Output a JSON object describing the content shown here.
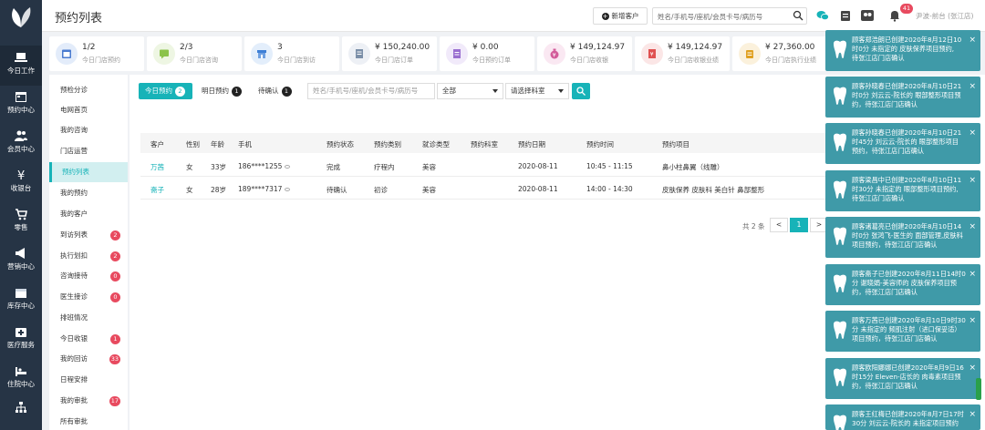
{
  "app": {
    "page_title": "预约列表",
    "new_customer_label": "新增客户",
    "search_placeholder": "姓名/手机号/座机/会员卡号/病历号",
    "notification_count": "41",
    "user_name": "尹波-前台 (张江店)",
    "accent_color": "#17b3b8"
  },
  "left_nav": [
    {
      "label": "今日工作",
      "icon": "laptop-icon"
    },
    {
      "label": "预约中心",
      "icon": "calendar-icon"
    },
    {
      "label": "会员中心",
      "icon": "users-icon"
    },
    {
      "label": "收银台",
      "icon": "yen-icon"
    },
    {
      "label": "零售",
      "icon": "cart-icon"
    },
    {
      "label": "营销中心",
      "icon": "megaphone-icon"
    },
    {
      "label": "库存中心",
      "icon": "box-icon"
    },
    {
      "label": "医疗服务",
      "icon": "medkit-icon"
    },
    {
      "label": "住院中心",
      "icon": "bed-icon"
    },
    {
      "label": "",
      "icon": "org-chart-icon"
    }
  ],
  "stats": [
    {
      "value": "1/2",
      "label": "今日门店预约",
      "color": "#4a7bd0",
      "bg": "#e3ecfa"
    },
    {
      "value": "2/3",
      "label": "今日门店咨询",
      "color": "#8bc34a",
      "bg": "#eef6e3"
    },
    {
      "value": "3",
      "label": "今日门店到访",
      "color": "#3d7fd6",
      "bg": "#e3eefb"
    },
    {
      "value": "¥ 150,240.00",
      "label": "今日门店订单",
      "color": "#7b8fa8",
      "bg": "#edf0f5"
    },
    {
      "value": "¥ 0.00",
      "label": "今日预约订单",
      "color": "#9a6fd0",
      "bg": "#f1eafa"
    },
    {
      "value": "¥ 149,124.97",
      "label": "今日门店收银",
      "color": "#d35d9a",
      "bg": "#fae8f2"
    },
    {
      "value": "¥ 149,124.97",
      "label": "今日门店收银业绩",
      "color": "#e05050",
      "bg": "#fbe6e6"
    },
    {
      "value": "¥ 27,360.00",
      "label": "今日门店执行业绩",
      "color": "#e0a020",
      "bg": "#fbf1dc"
    }
  ],
  "sub_nav": [
    {
      "label": "预检分诊",
      "badge": ""
    },
    {
      "label": "电网首页",
      "badge": ""
    },
    {
      "label": "我的咨询",
      "badge": ""
    },
    {
      "label": "门店运营",
      "badge": ""
    },
    {
      "label": "预约列表",
      "badge": "",
      "active": true
    },
    {
      "label": "我的预约",
      "badge": ""
    },
    {
      "label": "我的客户",
      "badge": ""
    },
    {
      "label": "到访列表",
      "badge": "2"
    },
    {
      "label": "执行划扣",
      "badge": "2"
    },
    {
      "label": "咨询接待",
      "badge": "0"
    },
    {
      "label": "医生接诊",
      "badge": "0"
    },
    {
      "label": "排班情况",
      "badge": ""
    },
    {
      "label": "今日收银",
      "badge": "1"
    },
    {
      "label": "我的回访",
      "badge": "33"
    },
    {
      "label": "日程安排",
      "badge": ""
    },
    {
      "label": "我的审批",
      "badge": "17"
    },
    {
      "label": "所有审批",
      "badge": ""
    }
  ],
  "tabs": [
    {
      "label": "今日预约",
      "count": "2",
      "active": true
    },
    {
      "label": "明日预约",
      "count": "1"
    },
    {
      "label": "待确认",
      "count": "1"
    }
  ],
  "filters": {
    "search_placeholder": "姓名/手机号/座机/会员卡号/病历号",
    "status": "全部",
    "department": "请选择科室"
  },
  "table": {
    "headers": [
      "客户",
      "性别",
      "年龄",
      "手机",
      "预约状态",
      "预约类别",
      "就诊类型",
      "预约科室",
      "预约日期",
      "预约时间",
      "预约项目"
    ],
    "rows": [
      [
        "万茜",
        "女",
        "33岁",
        "186****1255",
        "完成",
        "疗程内",
        "美容",
        "",
        "2020-08-11",
        "10:45 - 11:15",
        "鼻小柱鼻翼（线雕）"
      ],
      [
        "斋子",
        "女",
        "28岁",
        "189****7317",
        "待确认",
        "初诊",
        "美容",
        "",
        "2020-08-11",
        "14:00 - 14:30",
        "皮肤保养 皮肤科 美白针 鼻部整形"
      ]
    ]
  },
  "pagination": {
    "total": "共 2 条",
    "prev": "<",
    "current": "1",
    "next": ">"
  },
  "toasts": [
    {
      "lines": [
        "顾客郑浩朗已创建2020年8月12日10",
        "时0分 未指定的 皮肤保养项目预约,",
        "待张江店门店确认"
      ]
    },
    {
      "lines": [
        "顾客孙晓春已创建2020年8月10日21",
        "时0分 刘云云-院长的 眼部整形项目预",
        "约，待张江店门店确认"
      ]
    },
    {
      "lines": [
        "顾客孙晓春已创建2020年8月10日21",
        "时45分 刘云云-院长的 眼部整形项目",
        "预约，待张江店门店确认"
      ]
    },
    {
      "lines": [
        "顾客梁昌中已创建2020年8月10日11",
        "时30分 未指定的 眼部整形项目预约,",
        "待张江店门店确认"
      ]
    },
    {
      "lines": [
        "顾客诸葛亮已创建2020年8月10日14",
        "时0分 张鸿飞-医生的 面部管理,皮肤科",
        "项目预约，待张江店门店确认"
      ]
    },
    {
      "lines": [
        "顾客斋子已创建2020年8月11日14时0",
        "分 谢晓娟-美容师的 皮肤保养项目预",
        "约，待张江店门店确认"
      ]
    },
    {
      "lines": [
        "顾客万茜已创建2020年8月10日9时30",
        "分 未指定的 频肌注射（进口保妥适）",
        "项目预约，待张江店门店确认"
      ]
    },
    {
      "lines": [
        "顾客欧阳娜娜已创建2020年8月9日16",
        "时15分 Eleven-店长的 肉毒素项目预",
        "约，待张江店门店确认"
      ]
    },
    {
      "lines": [
        "顾客王红梅已创建2020年8月7日17时",
        "30分 刘云云-院长的 未指定项目预约"
      ]
    }
  ]
}
